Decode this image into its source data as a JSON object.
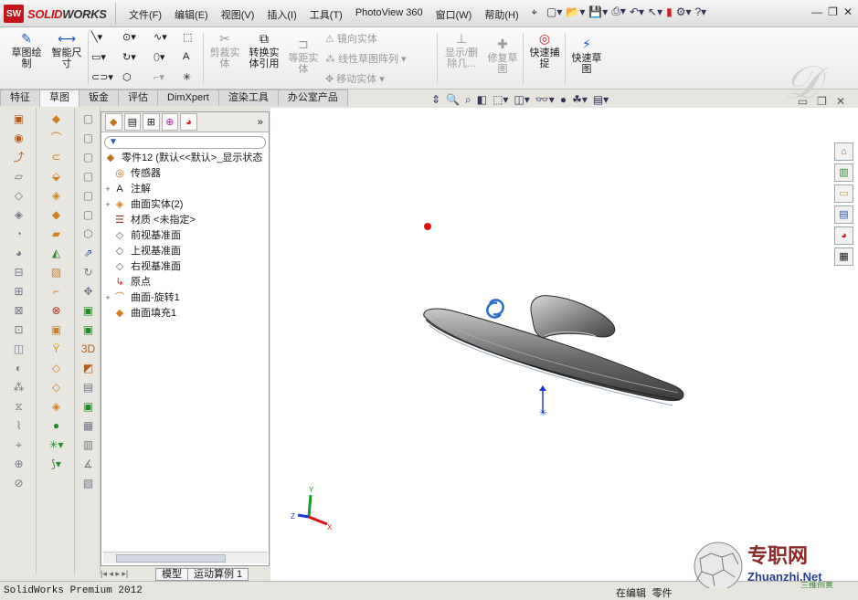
{
  "app": {
    "logo_prefix": "SOLID",
    "logo_suffix": "WORKS",
    "logo_badge": "SW",
    "menus": [
      "文件(F)",
      "编辑(E)",
      "视图(V)",
      "插入(I)",
      "工具(T)",
      "PhotoView 360",
      "窗口(W)",
      "帮助(H)"
    ]
  },
  "ribbon": {
    "sketch": "草图绘制",
    "smart_dim": "智能尺寸",
    "trim": "剪裁实体",
    "convert": "转换实体引用",
    "offset": "等距实体",
    "mirror": "镜向实体",
    "linear_pattern": "线性草图阵列",
    "move": "移动实体",
    "show_delete": "显示/删除几...",
    "repair": "修复草图",
    "quick_snap": "快速捕捉",
    "rapid_sketch": "快速草图"
  },
  "tabs": [
    "特征",
    "草图",
    "钣金",
    "评估",
    "DimXpert",
    "渲染工具",
    "办公室产品"
  ],
  "active_tab": "草图",
  "tree": {
    "root": "零件12  (默认<<默认>_显示状态",
    "items": [
      {
        "label": "传感器",
        "icon": "sensor-icon",
        "exp": ""
      },
      {
        "label": "注解",
        "icon": "annotation-icon",
        "exp": "+"
      },
      {
        "label": "曲面实体(2)",
        "icon": "surface-body-icon",
        "exp": "+"
      },
      {
        "label": "材质 <未指定>",
        "icon": "material-icon",
        "exp": ""
      },
      {
        "label": "前视基准面",
        "icon": "plane-icon",
        "exp": ""
      },
      {
        "label": "上视基准面",
        "icon": "plane-icon",
        "exp": ""
      },
      {
        "label": "右视基准面",
        "icon": "plane-icon",
        "exp": ""
      },
      {
        "label": "原点",
        "icon": "origin-icon",
        "exp": ""
      },
      {
        "label": "曲面-旋转1",
        "icon": "revolve-surface-icon",
        "exp": "+"
      },
      {
        "label": "曲面填充1",
        "icon": "fill-surface-icon",
        "exp": ""
      }
    ]
  },
  "bottom_tabs": [
    "模型",
    "运动算例 1"
  ],
  "status": {
    "left": "SolidWorks Premium 2012",
    "editing": "在编辑",
    "doc_type": "零件"
  },
  "watermark": {
    "title": "专职网",
    "url": "Zhuanzhi.Net",
    "sub": "三维创意"
  },
  "triad": {
    "x": "X",
    "y": "Y",
    "z": "Z"
  },
  "colors": {
    "brand_red": "#c4161c",
    "axis_x": "#d11",
    "axis_y": "#1a9a2a",
    "axis_z": "#1a3ad1"
  }
}
